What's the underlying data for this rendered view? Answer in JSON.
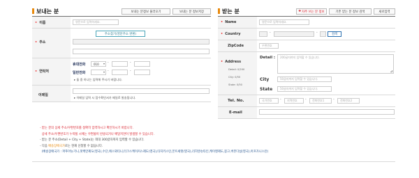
{
  "sender": {
    "title": "보내는 분",
    "load_button": "보내는 분정보 불러오기",
    "save_button": "보내는 분 정보저장",
    "name_label": "이름",
    "name_placeholder": "영문으로 입력하세요.",
    "address_label": "주소",
    "address_search_button": "주소찾기(영문주소 변환)",
    "contact_label": "연락처",
    "mobile_label": "휴대전화",
    "mobile_prefix": "010",
    "phone_label": "일반전화",
    "contact_hint": "둘 중 하나는 입력해 주시기 바랍니다.",
    "email_label": "이메일",
    "email_hint": "이메일 입력 시 접수확인서가 메일로 발송됩니다."
  },
  "receiver": {
    "title": "받는 분",
    "favorites_button": "자주 쓰는 분 정보",
    "history_button": "기존 받는 분 정보 검색",
    "new_button": "새로입력",
    "name_label": "Name",
    "name_placeholder": "영문으로 입력하세요.",
    "country_label": "Country",
    "search_button": "검색",
    "zipcode_label": "ZipCode",
    "zipcode_placeholder": "우편번호",
    "address_label": "Address",
    "detail_label": "Detail :",
    "detail_placeholder": "200글자까지 입력할 수 있습니다.",
    "detail_limit": "Detail: 0/200",
    "city_limit": "City: 0/50",
    "state_limit": "State: 0/50",
    "city_label": "City",
    "city_placeholder": "50글자까지 입력할 수 있습니다.",
    "state_label": "State",
    "state_placeholder": "50글자까지 입력할 수 있습니다.",
    "tel_label": "Tel. No.",
    "tel_country_placeholder": "국가번호",
    "tel_area_placeholder": "지역번호",
    "tel_num1_placeholder": "전화번호1",
    "tel_num2_placeholder": "전화번호2",
    "email_label": "E-mail"
  },
  "notes": {
    "line1": "받는 분의 상세 주소/우편번호를 정확히 입력하시고 확인하시기 바랍니다.",
    "line2": "상세 주소/우편번호가 누락될 시에는 우편물이 반송되거나 배달지연이 발생할 수 있습니다.",
    "line3": "받는 분 주소(Detail + City + State)는 최대 300글자까지 입력할 수 있습니다.",
    "line4a": "다음 ",
    "line4b": "배송장애국가",
    "line4c": "로는 현재 신청할 수 없습니다.",
    "line5": "(배송장애국가 : 파푸아뉴기니,팟케언제도(영국),수단,에스와티니,터크스케이커스제도(영국),타지키스탄,몬트세랫(영국),리히텐슈타인,케이맨제도,몽고,버뮤다섬(영국),아프가니스탄)"
  },
  "colors": {
    "accent": "#e8890c",
    "required_dot": "#e33333",
    "warning_red": "#d9232e",
    "navy": "#1f4f8a"
  }
}
